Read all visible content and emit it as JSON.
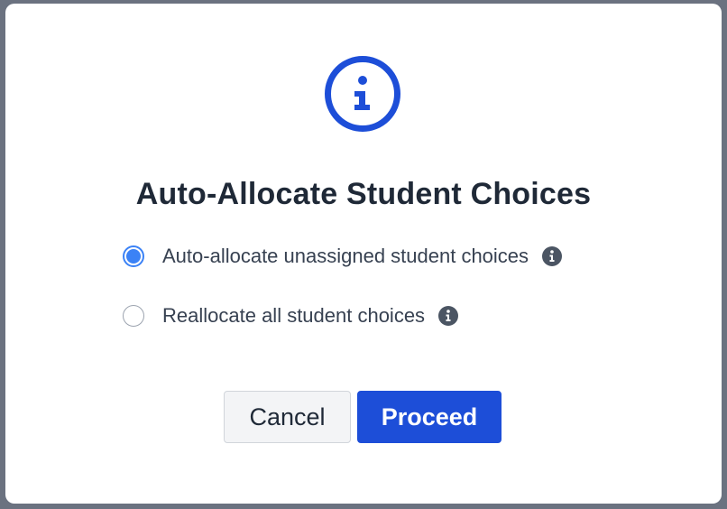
{
  "dialog": {
    "icon": "info-circle-icon",
    "title": "Auto-Allocate Student Choices",
    "options": [
      {
        "label": "Auto-allocate unassigned student choices",
        "selected": true,
        "help_icon": "info-icon"
      },
      {
        "label": "Reallocate all student choices",
        "selected": false,
        "help_icon": "info-icon"
      }
    ],
    "buttons": {
      "cancel_label": "Cancel",
      "proceed_label": "Proceed"
    }
  },
  "colors": {
    "accent": "#1d4ed8",
    "radio_selected": "#3b82f6",
    "title_text": "#1f2937",
    "body_text": "#374151"
  }
}
